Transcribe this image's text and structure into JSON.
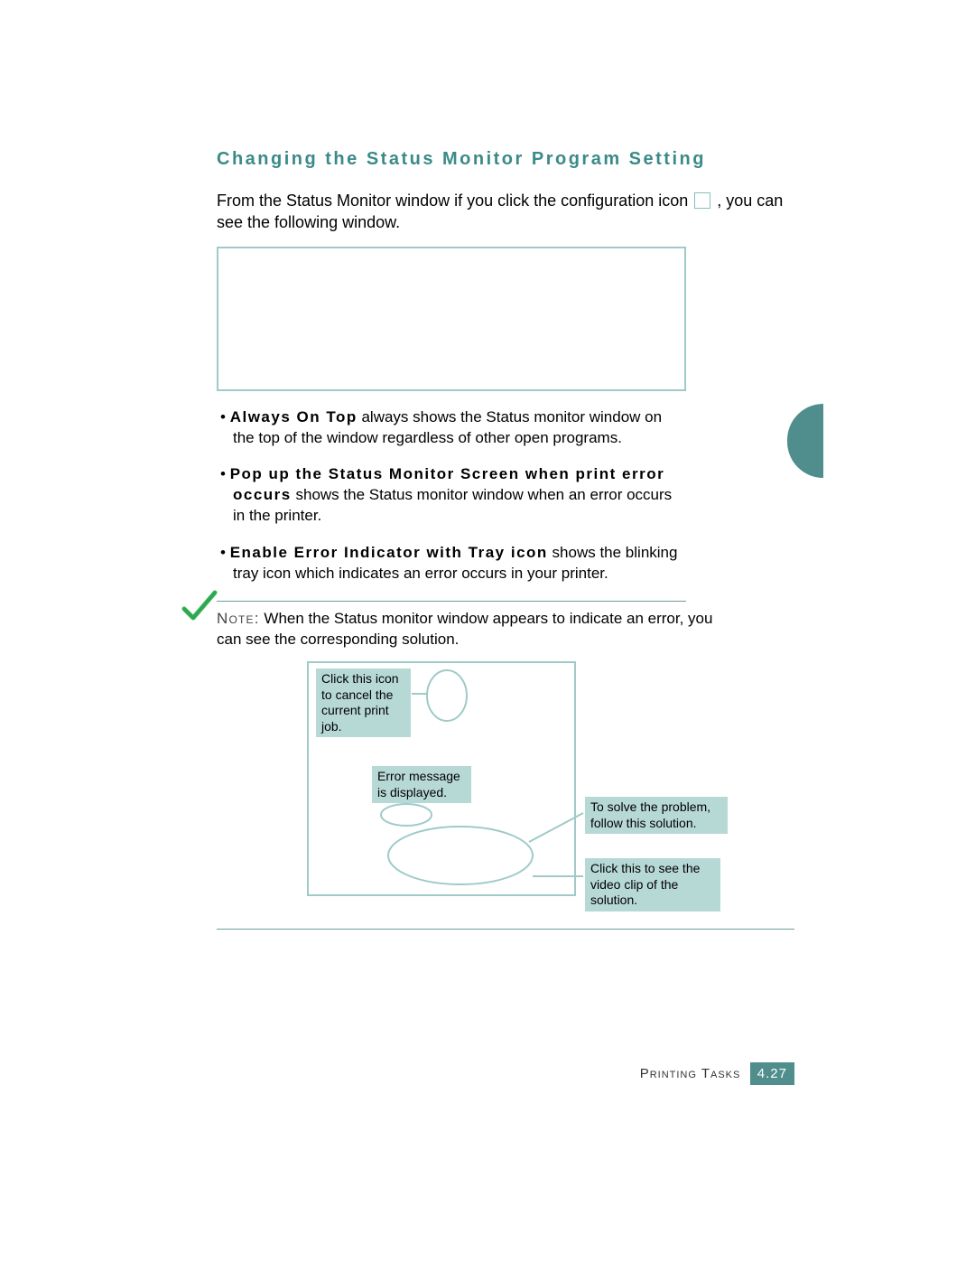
{
  "heading": "Changing the Status Monitor Program Setting",
  "intro_before": "From the Status Monitor window if you click the configuration icon ",
  "intro_after": ", you can see the following window.",
  "bullets": [
    {
      "bold": "Always On Top",
      "rest": " always shows the Status monitor window on the top of the window regardless of other open programs."
    },
    {
      "bold": "Pop up the Status Monitor Screen when print error occurs",
      "rest": " shows the Status monitor window when an error occurs in the printer."
    },
    {
      "bold": "Enable Error Indicator with Tray icon",
      "rest": " shows the blinking tray icon which indicates an error occurs in your printer."
    }
  ],
  "note": {
    "label": "Note:",
    "text": " When the Status monitor window appears to indicate an error, you can see the corresponding solution."
  },
  "callouts": {
    "cancel": "Click this icon to cancel the current print job.",
    "error": "Error message is displayed.",
    "solve": "To solve the problem, follow this solution.",
    "video": "Click this to see the video clip of the solution."
  },
  "footer": {
    "section": "Printing Tasks",
    "page": "4.27"
  }
}
